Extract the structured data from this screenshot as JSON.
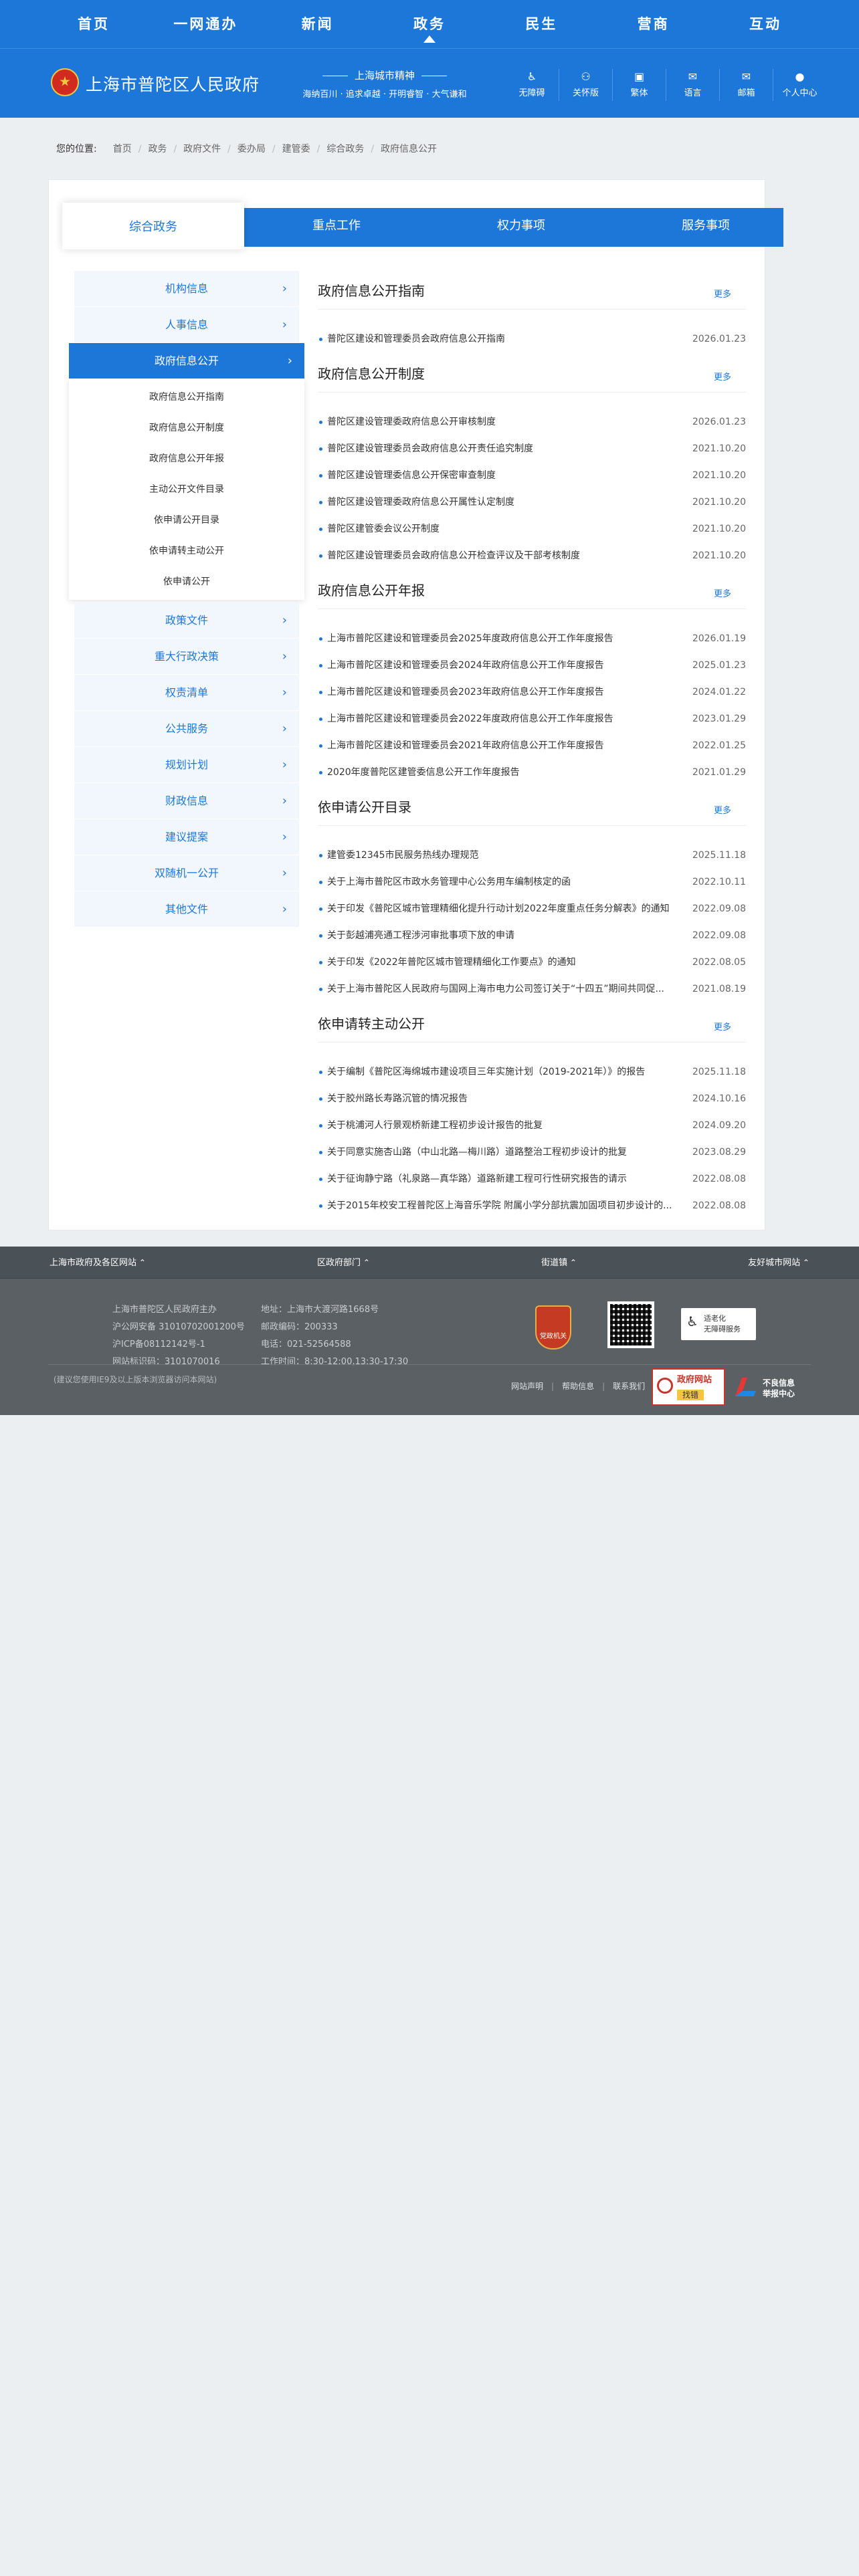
{
  "topnav": {
    "items": [
      "首页",
      "一网通办",
      "新闻",
      "政务",
      "民生",
      "营商",
      "互动"
    ],
    "active": "政务"
  },
  "header": {
    "site_name": "上海市普陀区人民政府",
    "spirit_title": "上海城市精神",
    "spirit_text": "海纳百川 · 追求卓越 · 开明睿智 · 大气谦和",
    "tools": [
      {
        "icon": "wheelchair-icon",
        "glyph": "♿",
        "label": "无障碍"
      },
      {
        "icon": "user-icon",
        "glyph": "⚇",
        "label": "关怀版"
      },
      {
        "icon": "traditional-icon",
        "glyph": "▣",
        "label": "繁体"
      },
      {
        "icon": "language-icon",
        "glyph": "✉",
        "label": "语言"
      },
      {
        "icon": "mail-icon",
        "glyph": "✉",
        "label": "邮箱"
      },
      {
        "icon": "account-icon",
        "glyph": "●",
        "label": "个人中心"
      }
    ]
  },
  "breadcrumb": {
    "lead": "您的位置:",
    "items": [
      "首页",
      "政务",
      "政府文件",
      "委办局",
      "建管委",
      "综合政务",
      "政府信息公开"
    ]
  },
  "tabs": [
    "综合政务",
    "重点工作",
    "权力事项",
    "服务事项"
  ],
  "sidebar": {
    "items_before": [
      "机构信息",
      "人事信息"
    ],
    "active": "政府信息公开",
    "submenu": [
      "政府信息公开指南",
      "政府信息公开制度",
      "政府信息公开年报",
      "主动公开文件目录",
      "依申请公开目录",
      "依申请转主动公开",
      "依申请公开"
    ],
    "items_after": [
      "政策文件",
      "重大行政决策",
      "权责清单",
      "公共服务",
      "规划计划",
      "财政信息",
      "建议提案",
      "双随机一公开",
      "其他文件"
    ]
  },
  "sections": [
    {
      "title": "政府信息公开指南",
      "more": "更多",
      "items": [
        {
          "text": "普陀区建设和管理委员会政府信息公开指南",
          "date": "2026.01.23"
        }
      ]
    },
    {
      "title": "政府信息公开制度",
      "more": "更多",
      "items": [
        {
          "text": "普陀区建设管理委政府信息公开审核制度",
          "date": "2026.01.23"
        },
        {
          "text": "普陀区建设管理委员会政府信息公开责任追究制度",
          "date": "2021.10.20"
        },
        {
          "text": "普陀区建设管理委信息公开保密审查制度",
          "date": "2021.10.20"
        },
        {
          "text": "普陀区建设管理委政府信息公开属性认定制度",
          "date": "2021.10.20"
        },
        {
          "text": "普陀区建管委会议公开制度",
          "date": "2021.10.20"
        },
        {
          "text": "普陀区建设管理委员会政府信息公开检查评议及干部考核制度",
          "date": "2021.10.20"
        }
      ]
    },
    {
      "title": "政府信息公开年报",
      "more": "更多",
      "items": [
        {
          "text": "上海市普陀区建设和管理委员会2025年度政府信息公开工作年度报告",
          "date": "2026.01.19"
        },
        {
          "text": "上海市普陀区建设和管理委员会2024年政府信息公开工作年度报告",
          "date": "2025.01.23"
        },
        {
          "text": "上海市普陀区建设和管理委员会2023年政府信息公开工作年度报告",
          "date": "2024.01.22"
        },
        {
          "text": "上海市普陀区建设和管理委员会2022年度政府信息公开工作年度报告",
          "date": "2023.01.29"
        },
        {
          "text": "上海市普陀区建设和管理委员会2021年政府信息公开工作年度报告",
          "date": "2022.01.25"
        },
        {
          "text": "2020年度普陀区建管委信息公开工作年度报告",
          "date": "2021.01.29"
        }
      ]
    },
    {
      "title": "依申请公开目录",
      "more": "更多",
      "items": [
        {
          "text": "建管委12345市民服务热线办理规范",
          "date": "2025.11.18"
        },
        {
          "text": "关于上海市普陀区市政水务管理中心公务用车编制核定的函",
          "date": "2022.10.11"
        },
        {
          "text": "关于印发《普陀区城市管理精细化提升行动计划2022年度重点任务分解表》的通知",
          "date": "2022.09.08"
        },
        {
          "text": "关于彭越浦亮通工程涉河审批事项下放的申请",
          "date": "2022.09.08"
        },
        {
          "text": "关于印发《2022年普陀区城市管理精细化工作要点》的通知",
          "date": "2022.08.05"
        },
        {
          "text": "关于上海市普陀区人民政府与国网上海市电力公司签订关于“十四五”期间共同促...",
          "date": "2021.08.19"
        }
      ]
    },
    {
      "title": "依申请转主动公开",
      "more": "更多",
      "items": [
        {
          "text": "关于编制《普陀区海绵城市建设项目三年实施计划（2019-2021年）》的报告",
          "date": "2025.11.18"
        },
        {
          "text": "关于胶州路长寿路沉管的情况报告",
          "date": "2024.10.16"
        },
        {
          "text": "关于桃浦河人行景观桥新建工程初步设计报告的批复",
          "date": "2024.09.20"
        },
        {
          "text": "关于同意实施杏山路（中山北路—梅川路）道路整治工程初步设计的批复",
          "date": "2023.08.29"
        },
        {
          "text": "关于征询静宁路（礼泉路—真华路）道路新建工程可行性研究报告的请示",
          "date": "2022.08.08"
        },
        {
          "text": "关于2015年校安工程普陀区上海音乐学院 附属小学分部抗震加固项目初步设计的...",
          "date": "2022.08.08"
        }
      ]
    }
  ],
  "footer": {
    "links": [
      "上海市政府及各区网站",
      "区政府部门",
      "街道镇",
      "友好城市网站"
    ],
    "sponsor": "上海市普陀区人民政府主办",
    "police_record": "沪公网安备 31010702001200号",
    "icp": "沪ICP备08112142号-1",
    "site_code": "网站标识码：3101070016",
    "address": "地址：上海市大渡河路1668号",
    "postcode": "邮政编码：200333",
    "phone": "电话：021-52564588",
    "hours": "工作时间：8:30-12:00,13:30-17:30",
    "badge": "党政机关",
    "aging_1": "适老化",
    "aging_2": "无障碍服务",
    "note": "(建议您使用IE9及以上版本浏览器访问本网站)",
    "misc": [
      "网站声明",
      "帮助信息",
      "联系我们"
    ],
    "jiucuo_1": "政府网站",
    "jiucuo_2": "找错",
    "report_1": "不良信息",
    "report_2": "举报中心"
  }
}
